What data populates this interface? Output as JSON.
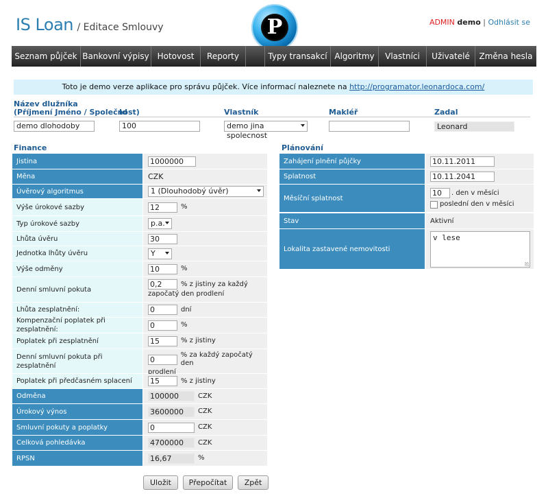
{
  "header": {
    "app_name": "IS Loan",
    "page_name": "/ Editace Smlouvy",
    "logo_letter": "P",
    "user_role": "ADMIN",
    "user_name": "demo",
    "separator": "|",
    "logout": "Odhlásit se"
  },
  "nav": [
    "Seznam půjček",
    "Bankovní výpisy",
    "Hotovost",
    "Reporty",
    "",
    "Typy transakcí",
    "Algoritmy",
    "Vlastníci",
    "Uživatelé",
    "Změna hesla"
  ],
  "banner": {
    "text": "Toto je demo verze aplikace pro správu půjček. Více informací naleznete na ",
    "link": "http://programator.leonardoca.com/"
  },
  "top_fields": {
    "debtor_label_1": "Název dlužníka",
    "debtor_label_2": "(Příjmení Jméno / Společnost)",
    "debtor_value": "demo dlohodoby",
    "id_label": "Id",
    "id_value": "100",
    "owner_label": "Vlastník",
    "owner_value": "demo jina spolecnost",
    "broker_label": "Makléř",
    "broker_value": "",
    "entered_by_label": "Zadal",
    "entered_by_value": "Leonard"
  },
  "finance": {
    "title": "Finance",
    "principal_label": "Jistina",
    "principal": "1000000",
    "currency_label": "Měna",
    "currency": "CZK",
    "algorithm_label": "Úvěrový algoritmus",
    "algorithm": "1 (Dlouhodobý úvěr)",
    "rate_label": "Výše úrokové sazby",
    "rate": "12",
    "rate_suffix": "%",
    "rate_type_label": "Typ úrokové sazby",
    "rate_type": "p.a.",
    "term_label": "Lhůta úvěru",
    "term": "30",
    "term_unit_label": "Jednotka lhůty úvěru",
    "term_unit": "Y",
    "fee_label": "Výše odměny",
    "fee": "10",
    "fee_suffix": "%",
    "daily_penalty_label": "Denní smluvní pokuta",
    "daily_penalty": "0,2",
    "daily_penalty_suffix_1": "% z jistiny za každý",
    "daily_penalty_suffix_2": "započatý den prodlení",
    "default_term_label": "Lhůta zesplatnění:",
    "default_term": "0",
    "default_term_suffix": "dní",
    "comp_fee_label": "Kompenzační poplatek při zesplatnění:",
    "comp_fee": "0",
    "comp_fee_suffix": "%",
    "accel_fee_label": "Poplatek při zesplatnění",
    "accel_fee": "15",
    "accel_fee_suffix": "% z jistiny",
    "accel_daily_label": "Denní smluvní pokuta při zesplatnění",
    "accel_daily": "0",
    "accel_daily_suffix_1": "% za každý započatý den",
    "accel_daily_suffix_2": "prodlení",
    "prepay_label": "Poplatek při předčasném splacení",
    "prepay": "15",
    "prepay_suffix": "% z jistiny",
    "reward_label": "Odměna",
    "reward": "100000",
    "reward_cur": "CZK",
    "interest_label": "Úrokový výnos",
    "interest": "3600000",
    "interest_cur": "CZK",
    "penalties_label": "Smluvní pokuty a poplatky",
    "penalties": "0",
    "penalties_cur": "CZK",
    "total_label": "Celková pohledávka",
    "total": "4700000",
    "total_cur": "CZK",
    "rpsn_label": "RPSN",
    "rpsn": "16,67",
    "rpsn_suffix": "%"
  },
  "planning": {
    "title": "Plánování",
    "start_label": "Zahájení plnění půjčky",
    "start": "10.11.2011",
    "maturity_label": "Splatnost",
    "maturity": "10.11.2041",
    "monthly_label": "Měsíční splatnost",
    "monthly_day": "10",
    "monthly_suffix": ". den v měsíci",
    "last_day_label": "poslední den v měsíci",
    "state_label": "Stav",
    "state": "Aktivní",
    "location_label": "Lokalita zastavené nemovitosti",
    "location": "v lese"
  },
  "buttons": {
    "save": "Uložit",
    "recalc": "Přepočítat",
    "back": "Zpět"
  }
}
